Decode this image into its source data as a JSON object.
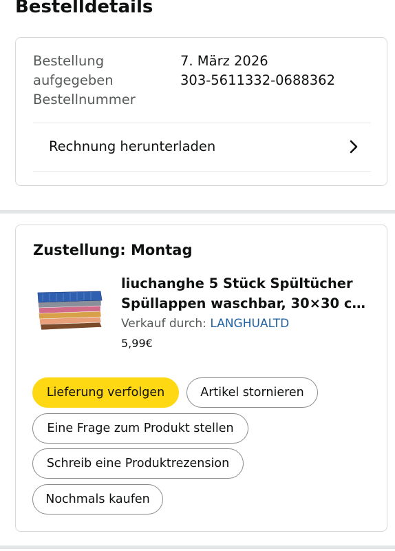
{
  "page": {
    "title": "Bestelldetails"
  },
  "order": {
    "placed_label_line1": "Bestellung",
    "placed_label_line2": "aufgegeben",
    "number_label": "Bestellnummer",
    "placed_date": "7. März 2026",
    "order_number": "303-5611332-0688362",
    "invoice_label": "Rechnung herunterladen"
  },
  "shipment": {
    "heading": "Zustellung: Montag",
    "product": {
      "title_line1": "liuchanghe 5 Stück Spültücher",
      "title_line2": "Spüllappen waschbar, 30×30 c…",
      "seller_prefix": "Verkauf durch: ",
      "seller_name": "LANGHUALTD",
      "price": "5,99€"
    },
    "actions": {
      "track": "Lieferung verfolgen",
      "cancel": "Artikel stornieren",
      "ask": "Eine Frage zum Produkt stellen",
      "review": "Schreib eine Produktrezension",
      "buy_again": "Nochmals kaufen"
    }
  },
  "colors": {
    "primary_button": "#ffd814",
    "link": "#2162a1",
    "secondary_text": "#565959",
    "border": "#d5d9d9"
  },
  "icons": {
    "invoice_chevron": "chevron-right-icon"
  }
}
